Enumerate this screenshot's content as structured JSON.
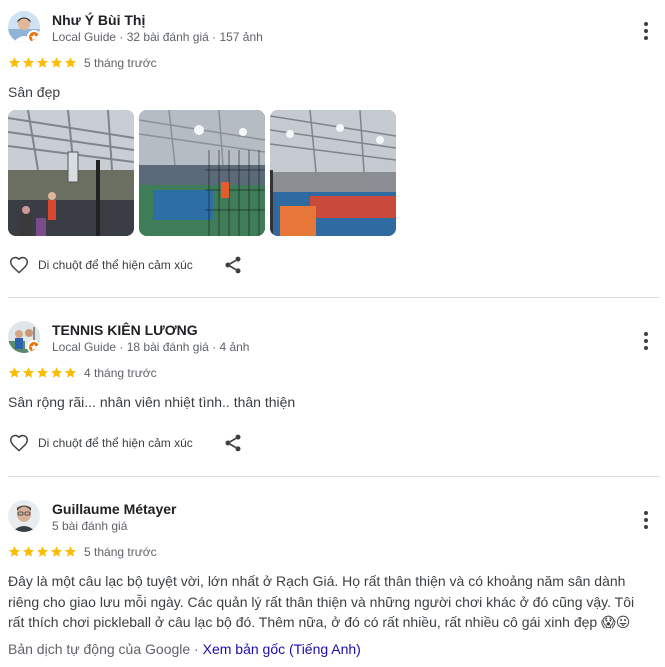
{
  "reviews": [
    {
      "name": "Như Ý Bùi Thị",
      "meta": "Local Guide · 32 bài đánh giá · 157 ảnh",
      "rating": 5,
      "time": "5 tháng trước",
      "text": "Sân đẹp",
      "photos": [
        "photo-1",
        "photo-2",
        "photo-3"
      ],
      "react_label": "Di chuột để thể hiện cảm xúc"
    },
    {
      "name": "TENNIS KIÊN LƯƠNG",
      "meta": "Local Guide · 18 bài đánh giá · 4 ảnh",
      "rating": 5,
      "time": "4 tháng trước",
      "text": "Sân rộng rãi... nhân viên nhiệt tình.. thân thiện",
      "react_label": "Di chuột để thể hiện cảm xúc"
    },
    {
      "name": "Guillaume Métayer",
      "meta": "5 bài đánh giá",
      "rating": 5,
      "time": "5 tháng trước",
      "text": "Đây là một câu lạc bộ tuyệt vời, lớn nhất ở Rạch Giá. Họ rất thân thiện và có khoảng năm sân dành riêng cho giao lưu mỗi ngày. Các quản lý rất thân thiện và những người chơi khác ở đó cũng vậy. Tôi rất thích chơi pickleball ở câu lạc bộ đó. Thêm nữa, ở đó có rất nhiều, rất nhiều cô gái xinh đẹp 😱😛",
      "translation_note": "Bản dịch tự động của Google · ",
      "translation_link": "Xem bản gốc (Tiếng Anh)"
    }
  ],
  "colors": {
    "star": "#fbbc04",
    "guide_badge": "#e8710a",
    "link": "#1a0dab",
    "divider": "#dadce0"
  }
}
